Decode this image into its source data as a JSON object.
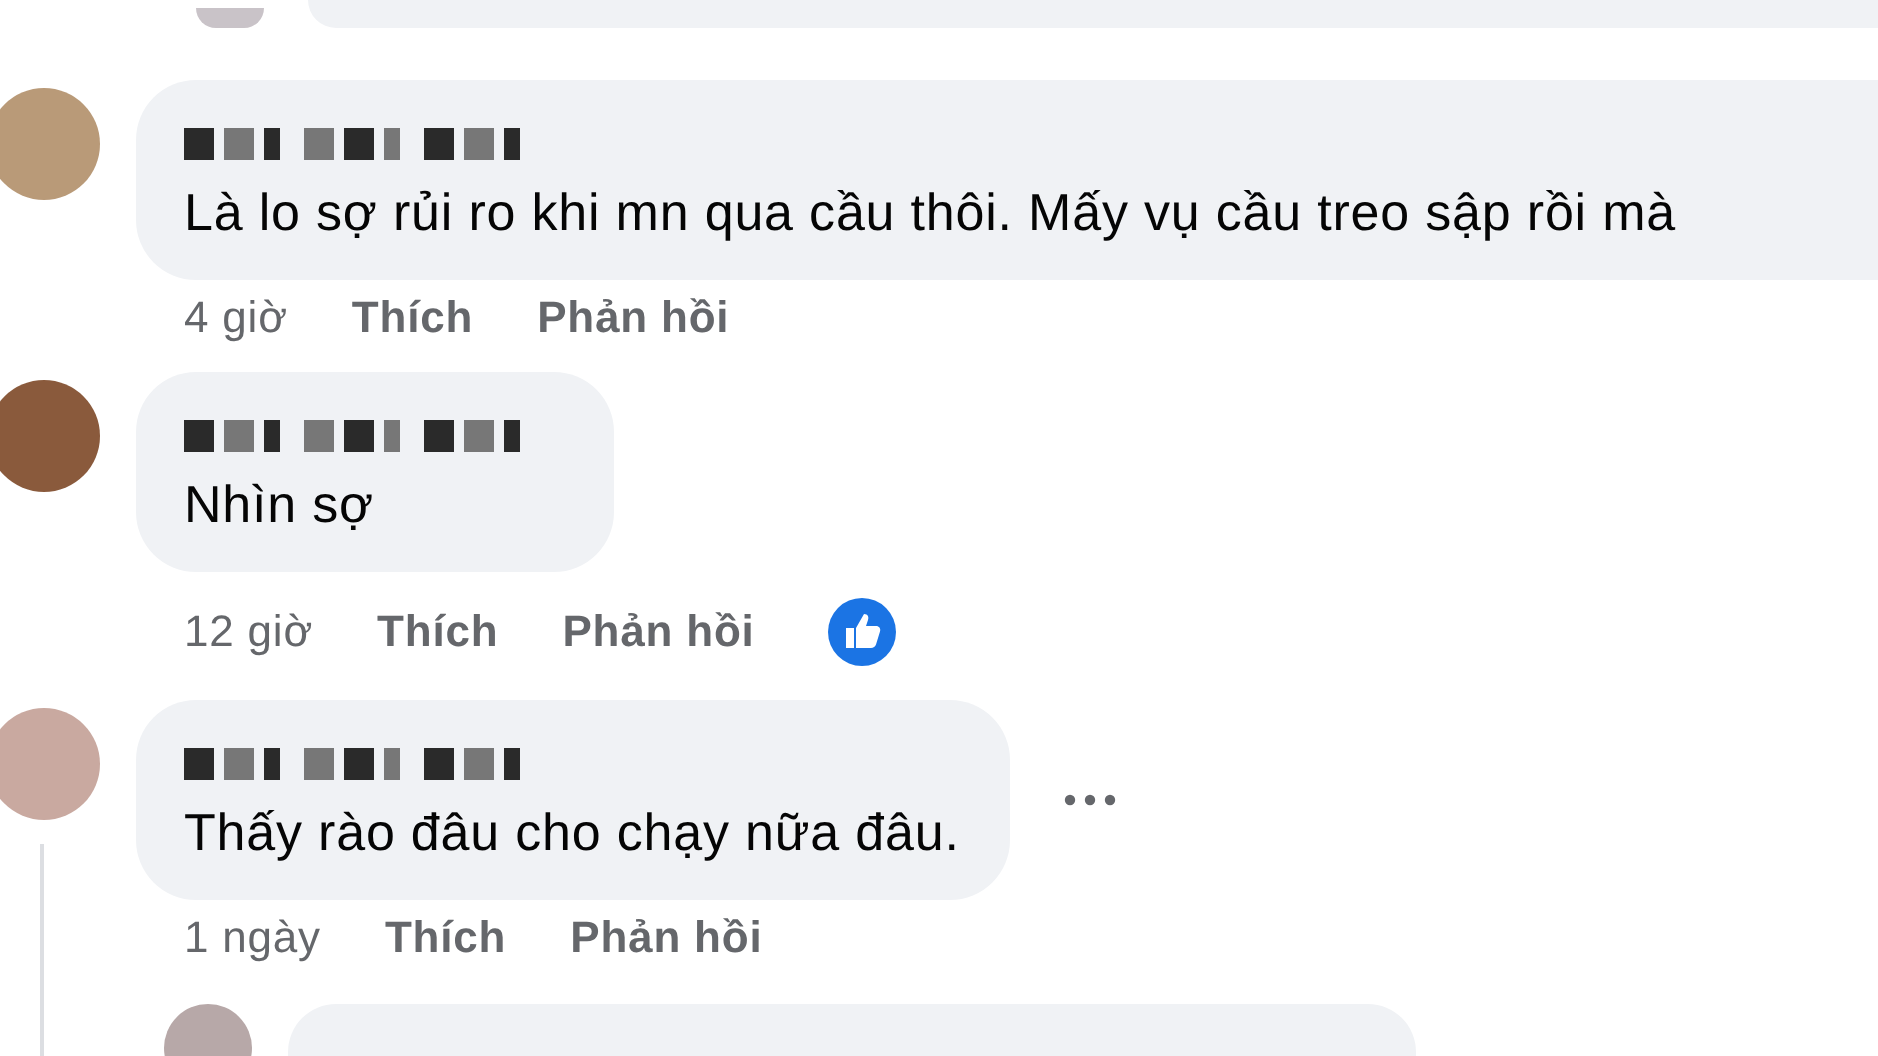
{
  "comments": [
    {
      "text": "Là lo sợ rủi ro khi mn qua cầu thôi. Mấy vụ cầu treo sập rồi mà",
      "time": "4 giờ",
      "like_label": "Thích",
      "reply_label": "Phản hồi",
      "has_like_reaction": false,
      "has_menu": false,
      "has_replies": false
    },
    {
      "text": "Nhìn sợ",
      "time": "12 giờ",
      "like_label": "Thích",
      "reply_label": "Phản hồi",
      "has_like_reaction": true,
      "has_menu": false,
      "has_replies": false
    },
    {
      "text": "Thấy rào đâu cho chạy nữa đâu.",
      "time": "1 ngày",
      "like_label": "Thích",
      "reply_label": "Phản hồi",
      "has_like_reaction": false,
      "has_menu": true,
      "has_replies": true
    }
  ]
}
